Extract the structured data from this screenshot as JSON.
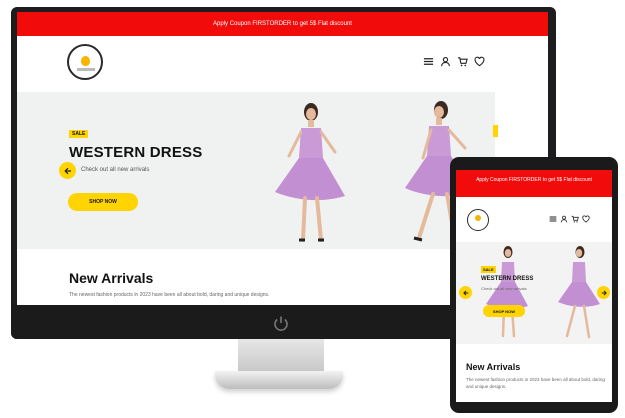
{
  "desktop": {
    "coupon_banner": "Apply Coupon FIRSTORDER to get 5$ Flat discount",
    "hero": {
      "badge": "SALE",
      "title": "WESTERN DRESS",
      "subtitle": "Check out all new arrivals",
      "button": "SHOP NOW"
    },
    "new_arrivals": {
      "heading": "New Arrivals",
      "description": "The newest fashion products in 2023 have been all about bold, daring and unique designs."
    }
  },
  "tablet": {
    "coupon_banner": "Apply Coupon FIRSTORDER to get 5$ Flat discount",
    "hero": {
      "badge": "SALE",
      "title": "WESTERN DRESS",
      "subtitle": "Check out all new arrivals",
      "button": "SHOP NOW"
    },
    "new_arrivals": {
      "heading": "New Arrivals",
      "description": "The newest fashion products in 2023 have been all about bold, daring and unique designs."
    }
  },
  "icons": [
    "menu-icon",
    "user-icon",
    "cart-icon",
    "heart-icon",
    "arrow-left-icon",
    "arrow-right-icon",
    "power-icon"
  ],
  "colors": {
    "banner": "#f20b0b",
    "accent": "#ffd400",
    "dress": "#c99ad6",
    "device_frame": "#1d1d1f"
  }
}
